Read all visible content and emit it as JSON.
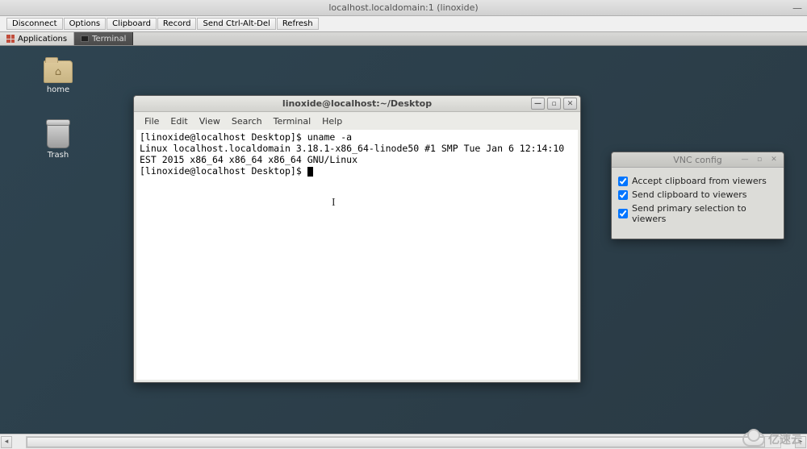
{
  "viewer": {
    "title": "localhost.localdomain:1 (linoxide)",
    "toolbar": {
      "disconnect": "Disconnect",
      "options": "Options",
      "clipboard": "Clipboard",
      "record": "Record",
      "send_cad": "Send Ctrl-Alt-Del",
      "refresh": "Refresh"
    }
  },
  "taskbar": {
    "applications": "Applications",
    "terminal_tab": "Terminal"
  },
  "desktop": {
    "home_label": "home",
    "trash_label": "Trash"
  },
  "terminal": {
    "title": "linoxide@localhost:~/Desktop",
    "menus": {
      "file": "File",
      "edit": "Edit",
      "view": "View",
      "search": "Search",
      "terminal": "Terminal",
      "help": "Help"
    },
    "line1": "[linoxide@localhost Desktop]$ uname -a",
    "line2": "Linux localhost.localdomain 3.18.1-x86_64-linode50 #1 SMP Tue Jan 6 12:14:10 EST 2015 x86_64 x86_64 x86_64 GNU/Linux",
    "line3": "[linoxide@localhost Desktop]$ "
  },
  "vnc_config": {
    "title": "VNC config",
    "opt1": "Accept clipboard from viewers",
    "opt2": "Send clipboard to viewers",
    "opt3": "Send primary selection to viewers"
  },
  "watermark": "亿速云"
}
